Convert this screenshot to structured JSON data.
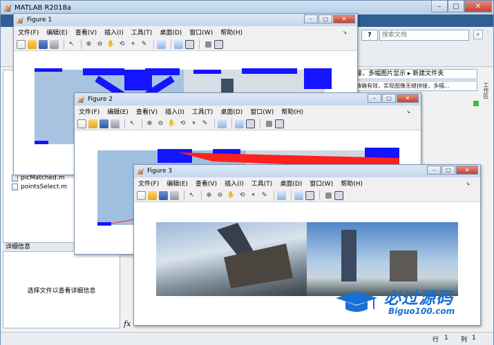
{
  "app": {
    "title": "MATLAB R2018a",
    "controls": [
      "–",
      "□",
      "✕"
    ]
  },
  "ribbon": {
    "help": "?",
    "search_placeholder": "搜索文档",
    "address": "接，多幅图片显示 ▸ 新建文件夹",
    "tab_tooltip": "精确有效，实现图像无缝拼接，多幅...",
    "side_tab": "工作区"
  },
  "files": [
    {
      "name": "picMatched.m"
    },
    {
      "name": "pointsSelect.m"
    }
  ],
  "details": {
    "header": "详细信息",
    "empty_text": "选择文件以查看详细信息"
  },
  "command": {
    "fx": "fx"
  },
  "status": {
    "row_label": "行",
    "row_value": "1",
    "col_label": "列",
    "col_value": "1"
  },
  "figure_menu": [
    "文件(F)",
    "编辑(E)",
    "查看(V)",
    "插入(I)",
    "工具(T)",
    "桌面(D)",
    "窗口(W)",
    "帮助(H)"
  ],
  "figures": [
    {
      "title": "Figure 1"
    },
    {
      "title": "Figure 2"
    },
    {
      "title": "Figure 3"
    }
  ],
  "watermark": {
    "text": "必过源码",
    "subtext": "Biguo100.com"
  },
  "colors": {
    "marker_blue": "#1414ff",
    "match_red": "#ff2020",
    "titlebar": "#c6d8ec",
    "watermark": "#1a6fd4"
  }
}
